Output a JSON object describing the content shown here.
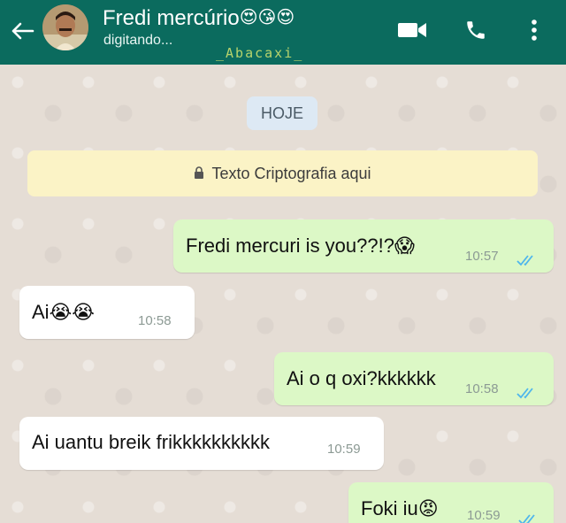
{
  "header": {
    "contact_name": "Fredi mercúrio",
    "name_emojis": "😍😘😍",
    "status": "digitando...",
    "watermark": "_Abacaxi_"
  },
  "chat": {
    "date_label": "HOJE",
    "encryption_notice": "Texto Criptografia aqui",
    "messages": [
      {
        "direction": "out",
        "text": "Fredi mercuri is you??!?",
        "emoji": "😱",
        "time": "10:57",
        "read": true
      },
      {
        "direction": "in",
        "text": "Ai",
        "emoji": "😭😭",
        "time": "10:58"
      },
      {
        "direction": "out",
        "text": "Ai o q oxi?kkkkkk",
        "emoji": "",
        "time": "10:58",
        "read": true
      },
      {
        "direction": "in",
        "text": "Ai uantu breik frikkkkkkkkkk",
        "emoji": "",
        "time": "10:59"
      },
      {
        "direction": "out",
        "text": "Foki iu",
        "emoji": "😡",
        "time": "10:59",
        "read": true
      }
    ]
  },
  "colors": {
    "header": "#0b6b5e",
    "outgoing_bubble": "#dcf8c6",
    "incoming_bubble": "#ffffff",
    "read_ticks": "#4fb6ec",
    "chat_background": "#e5ddd5"
  }
}
